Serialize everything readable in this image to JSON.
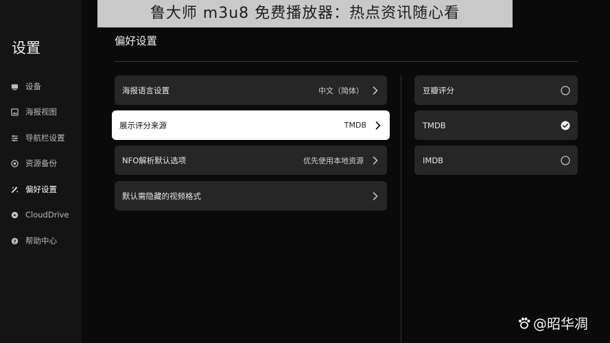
{
  "banner": "鲁大师 m3u8 免费播放器：热点资讯随心看",
  "sidebar": {
    "title": "设置",
    "items": [
      {
        "label": "设备",
        "icon": "device-icon"
      },
      {
        "label": "海报视图",
        "icon": "poster-view-icon"
      },
      {
        "label": "导航栏设置",
        "icon": "navbar-settings-icon"
      },
      {
        "label": "资源备份",
        "icon": "backup-icon"
      },
      {
        "label": "偏好设置",
        "icon": "preferences-icon",
        "active": true
      },
      {
        "label": "CloudDrive",
        "icon": "cloud-drive-icon"
      },
      {
        "label": "帮助中心",
        "icon": "help-icon"
      }
    ]
  },
  "main": {
    "title": "偏好设置",
    "settings": [
      {
        "label": "海报语言设置",
        "value": "中文（简体）"
      },
      {
        "label": "展示评分来源",
        "value": "TMDB",
        "selected": true
      },
      {
        "label": "NFO解析默认选项",
        "value": "优先使用本地资源"
      },
      {
        "label": "默认需隐藏的视频格式",
        "value": ""
      }
    ],
    "options": [
      {
        "label": "豆瓣评分",
        "checked": false
      },
      {
        "label": "TMDB",
        "checked": true
      },
      {
        "label": "IMDB",
        "checked": false
      }
    ]
  },
  "watermark": "@昭华凋",
  "colors": {
    "background": "#0a0a0a",
    "sidebar": "#141414",
    "card": "#262626",
    "selected_card": "#ffffff",
    "banner": "#c9c9c9"
  }
}
